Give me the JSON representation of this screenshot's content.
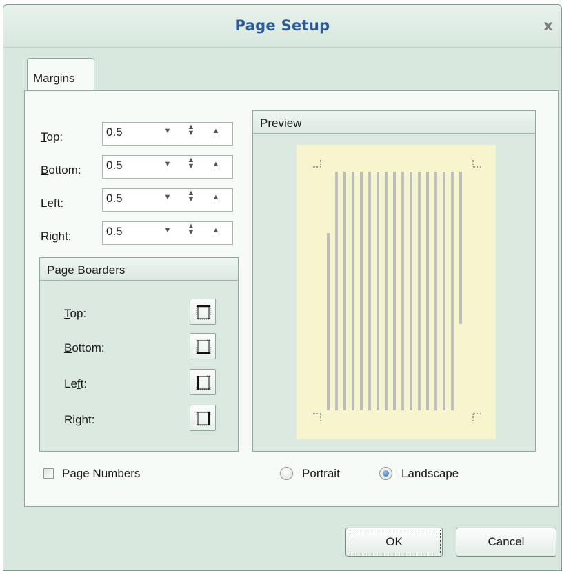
{
  "dialog": {
    "title": "Page Setup",
    "close_glyph": "x"
  },
  "tabs": [
    {
      "label": "Margins",
      "selected": true
    }
  ],
  "margins": {
    "top": {
      "label_underline": "T",
      "label_rest": "op:",
      "value": "0.5"
    },
    "bottom": {
      "label_underline": "B",
      "label_rest": "ottom:",
      "value": "0.5"
    },
    "left": {
      "label_before": "Le",
      "label_underline": "f",
      "label_after": "t:",
      "value": "0.5"
    },
    "right": {
      "label_before": "Ri",
      "label_underline": "g",
      "label_after": "ht:",
      "value": "0.5"
    }
  },
  "page_borders": {
    "title": "Page Boarders",
    "top": {
      "label_underline": "T",
      "label_rest": "op:"
    },
    "bottom": {
      "label_underline": "B",
      "label_rest": "ottom:"
    },
    "left": {
      "label_before": "Le",
      "label_underline": "f",
      "label_after": "t:"
    },
    "right": {
      "label_before": "Ri",
      "label_underline": "g",
      "label_after": "ht:"
    }
  },
  "preview": {
    "title": "Preview",
    "paper_color": "#f6f5cd",
    "line_color": "#bfbfbf"
  },
  "options": {
    "page_numbers_label": "Page Numbers",
    "page_numbers_checked": false,
    "orientation": {
      "portrait_label": "Portrait",
      "landscape_label": "Landscape",
      "selected": "Landscape"
    }
  },
  "buttons": {
    "ok_label": "OK",
    "cancel_label": "Cancel"
  },
  "colors": {
    "title_text": "#2b5c98",
    "dialog_bg": "#d9e8df",
    "radio_accent": "#2c66b4"
  }
}
